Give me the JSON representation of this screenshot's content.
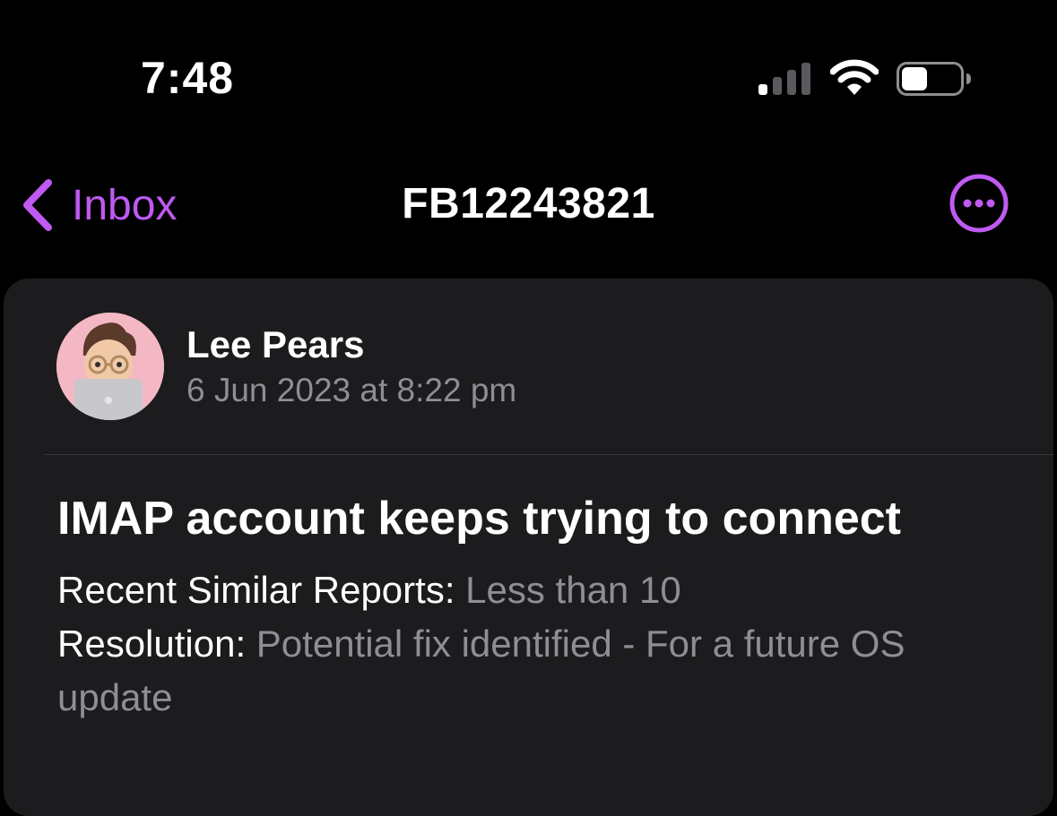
{
  "status_bar": {
    "time": "7:48",
    "icons": [
      "cellular-signal-icon",
      "wifi-icon",
      "battery-icon"
    ]
  },
  "nav": {
    "back_label": "Inbox",
    "title": "FB12243821",
    "more_icon": "ellipsis-circle-icon"
  },
  "message": {
    "sender": "Lee Pears",
    "date": "6 Jun 2023 at 8:22 pm",
    "subject": "IMAP account keeps trying to connect",
    "similar_reports_label": "Recent Similar Reports:",
    "similar_reports_value": "Less than 10",
    "resolution_label": "Resolution:",
    "resolution_value": "Potential fix identified - For a future OS update"
  },
  "colors": {
    "accent": "#bf5af2",
    "background": "#000000",
    "card": "#1c1c1e",
    "secondary_text": "#8e8e93"
  }
}
